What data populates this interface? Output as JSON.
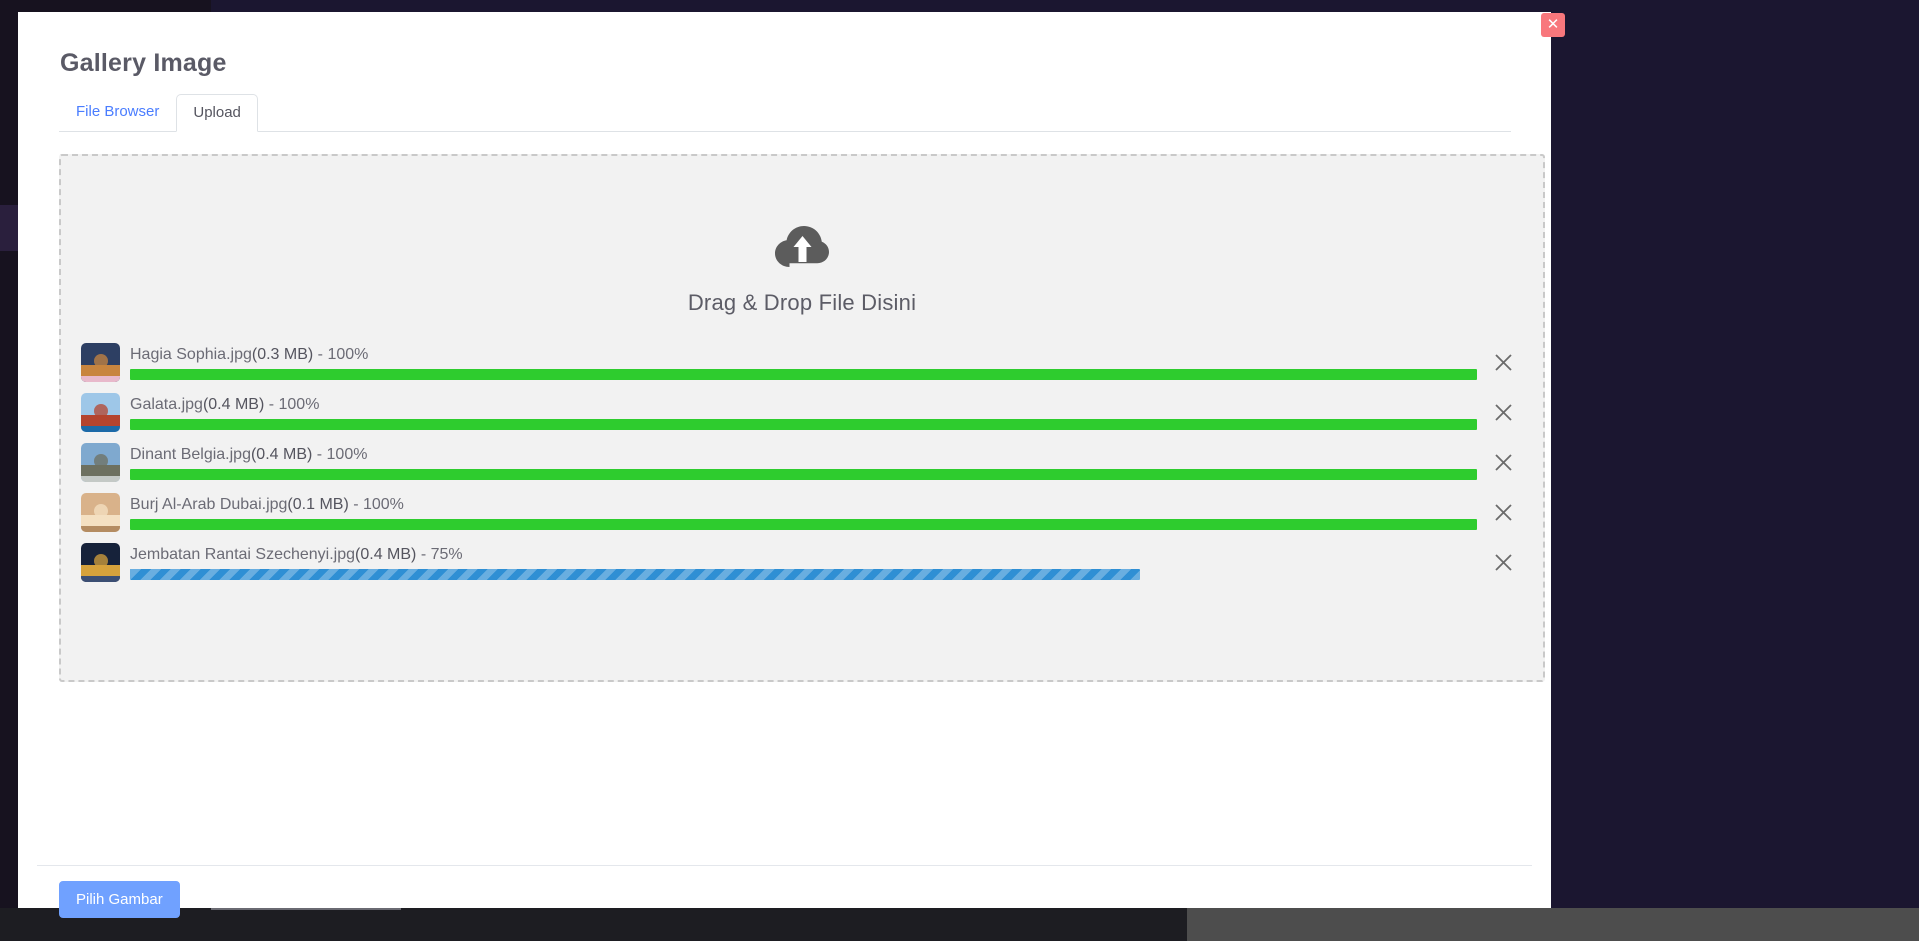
{
  "modal": {
    "title": "Gallery Image",
    "close_label": "✕"
  },
  "tabs": [
    {
      "label": "File Browser",
      "active": false
    },
    {
      "label": "Upload",
      "active": true
    }
  ],
  "dropzone": {
    "hint_text": "Drag & Drop File Disini",
    "icon": "cloud-upload-icon"
  },
  "files": [
    {
      "name": "Hagia Sophia.jpg",
      "size": "(0.3 MB)",
      "separator": " - ",
      "percent_label": "100%",
      "percent": 100,
      "state": "done",
      "remove_label": "✕",
      "thumb_colors": [
        "#2d3f63",
        "#c8853f",
        "#e8b9cb"
      ]
    },
    {
      "name": "Galata.jpg",
      "size": "(0.4 MB)",
      "separator": " - ",
      "percent_label": "100%",
      "percent": 100,
      "state": "done",
      "remove_label": "✕",
      "thumb_colors": [
        "#9ec7e8",
        "#b4442f",
        "#1c6aa8"
      ]
    },
    {
      "name": "Dinant Belgia.jpg",
      "size": "(0.4 MB)",
      "separator": " - ",
      "percent_label": "100%",
      "percent": 100,
      "state": "done",
      "remove_label": "✕",
      "thumb_colors": [
        "#7fa9cf",
        "#6d7060",
        "#c4c9c6"
      ]
    },
    {
      "name": "Burj Al-Arab Dubai.jpg",
      "size": "(0.1 MB)",
      "separator": " - ",
      "percent_label": "100%",
      "percent": 100,
      "state": "done",
      "remove_label": "✕",
      "thumb_colors": [
        "#d9b28a",
        "#f4e0c2",
        "#b48c62"
      ]
    },
    {
      "name": "Jembatan Rantai Szechenyi.jpg",
      "size": "(0.4 MB)",
      "separator": " - ",
      "percent_label": "75%",
      "percent": 75,
      "state": "uploading",
      "remove_label": "✕",
      "thumb_colors": [
        "#16223a",
        "#d6a23c",
        "#3c4f74"
      ]
    }
  ],
  "footer": {
    "submit_label": "Pilih Gambar"
  },
  "colors": {
    "progress_done": "#2ecc2e",
    "progress_active": "#2f8fd4",
    "accent_button": "#70a1ff",
    "close_button": "#f8777c",
    "tab_link": "#4a7dff",
    "dropzone_bg": "#f2f2f2"
  }
}
